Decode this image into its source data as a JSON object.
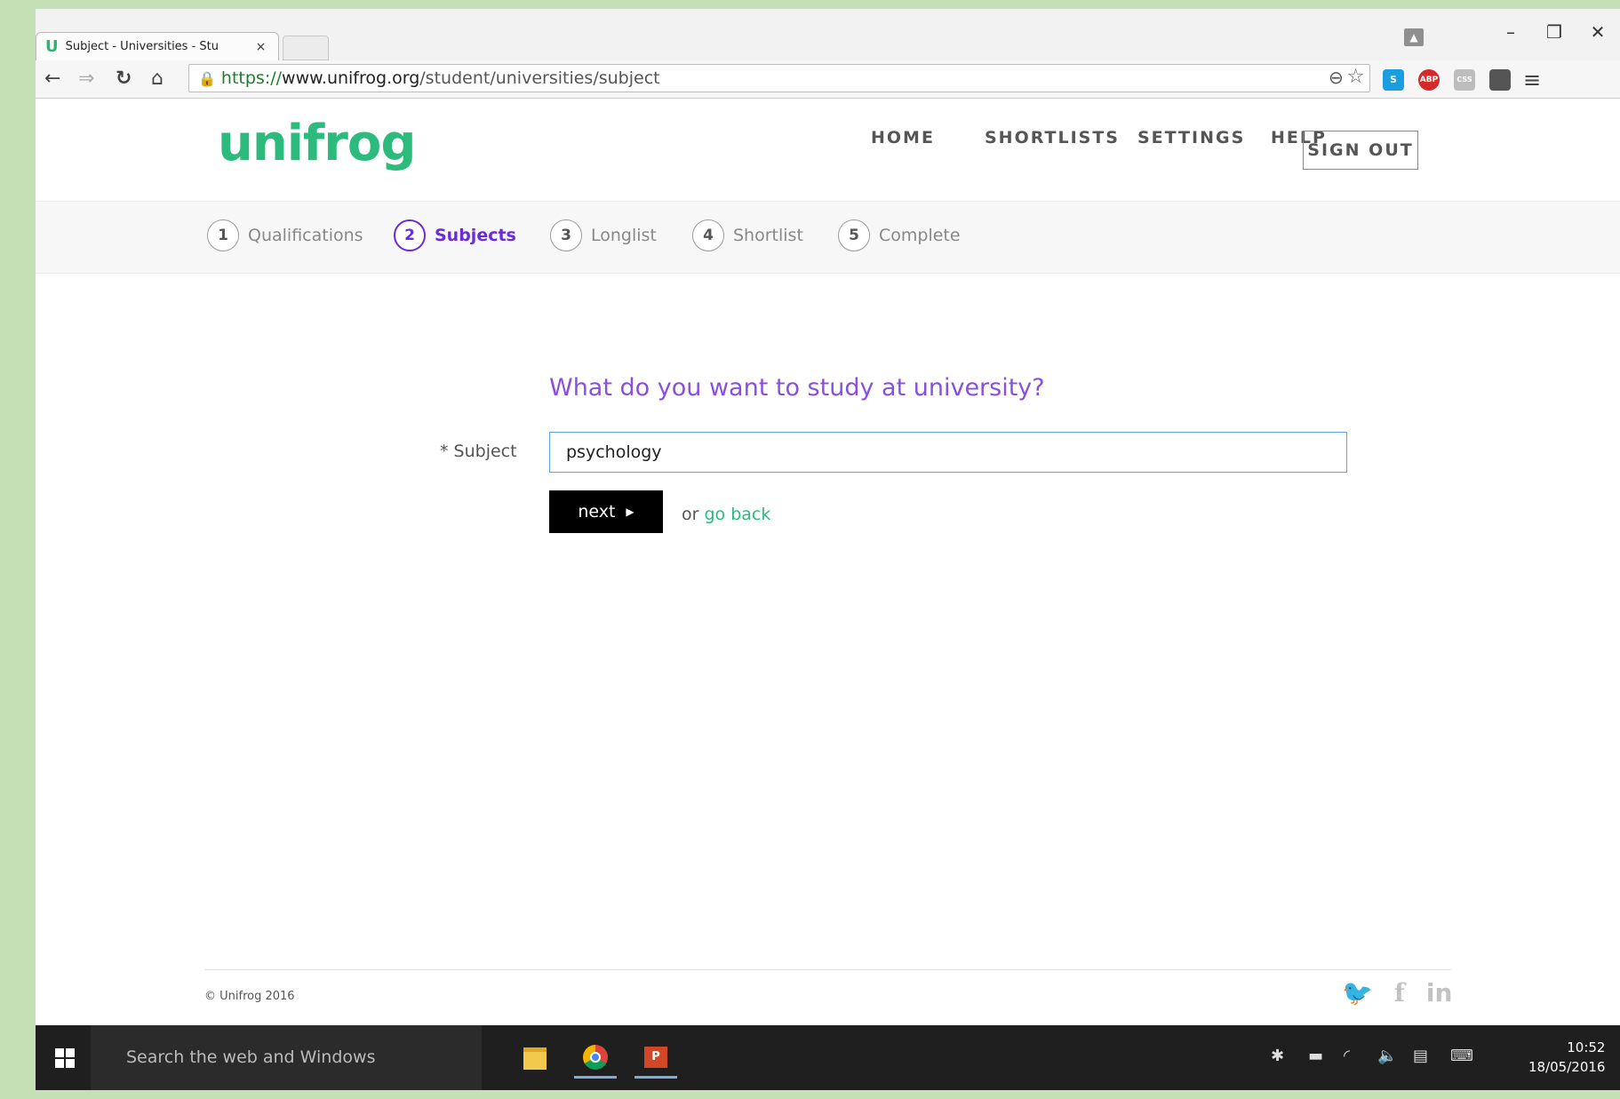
{
  "browser": {
    "tab_title": "Subject - Universities - Stu",
    "tab_close": "×",
    "url_secure": "https://",
    "url_domain": "www.unifrog.org",
    "url_path": "/student/universities/subject",
    "window_controls": {
      "minimize": "–",
      "restore": "❐",
      "close": "✕"
    },
    "ext_labels": {
      "skype": "S",
      "abp": "ABP",
      "css": "CSS"
    }
  },
  "site": {
    "logo": "unifrog",
    "nav": [
      "HOME",
      "SHORTLISTS",
      "SETTINGS",
      "HELP"
    ],
    "sign_out": "SIGN OUT"
  },
  "steps": [
    {
      "num": "1",
      "label": "Qualifications",
      "active": false
    },
    {
      "num": "2",
      "label": "Subjects",
      "active": true
    },
    {
      "num": "3",
      "label": "Longlist",
      "active": false
    },
    {
      "num": "4",
      "label": "Shortlist",
      "active": false
    },
    {
      "num": "5",
      "label": "Complete",
      "active": false
    }
  ],
  "form": {
    "question": "What do you want to study at university?",
    "subject_label": "* Subject",
    "subject_value": "psychology",
    "next_label": "next",
    "or_text": "or ",
    "go_back": "go back"
  },
  "footer": {
    "copyright": "© Unifrog 2016"
  },
  "taskbar": {
    "search_placeholder": "Search the web and Windows",
    "time": "10:52",
    "date": "18/05/2016"
  },
  "colors": {
    "brand_green": "#2cbb7d",
    "accent_purple": "#6a2bd9",
    "question_purple": "#8a4fe0"
  }
}
